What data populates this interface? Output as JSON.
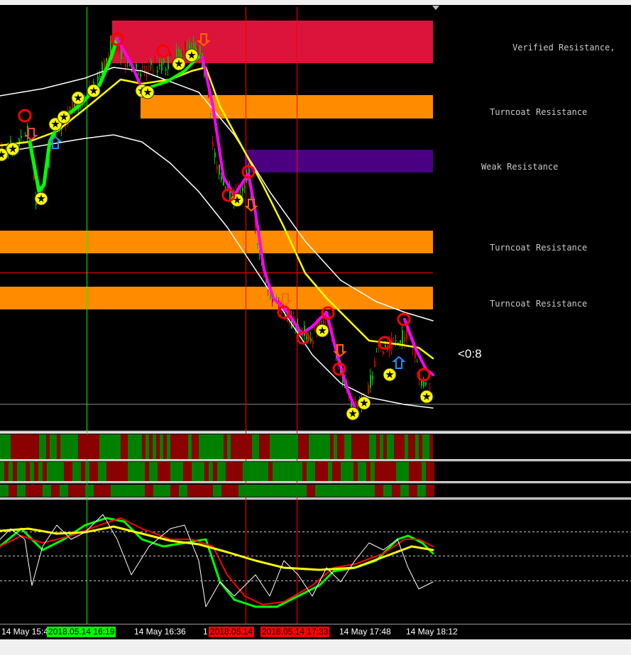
{
  "chart": {
    "zone_labels": {
      "verified": "Verified Resistance,",
      "turncoat_1": "Turncoat Resistance",
      "weak": "Weak Resistance",
      "turncoat_2": "Turncoat Resistance",
      "turncoat_3": "Turncoat Resistance"
    },
    "countdown": "<0:8",
    "time_axis": {
      "t1": "14 May 15:48",
      "t2": "2018.05.14 16:19",
      "t3": "14 May 16:36",
      "t4": "1",
      "t5": "2018.05.14",
      "t6": "2018.05.14 17:33",
      "t7": "14 May 17:48",
      "t8": "14 May 18:12"
    },
    "colors": {
      "background": "#000000",
      "verified_zone": "#dc143c",
      "turncoat_zone": "#ff8c00",
      "weak_zone": "#4b0082",
      "bull": "#008000",
      "bear": "#8b0000",
      "yellow_ma": "#ffff00",
      "envelope": "#ffffff",
      "magenta_line": "#ff00ff",
      "green_line": "#00ff00",
      "vline_green": "#00ff00",
      "vline_red": "#ff0000"
    }
  }
}
